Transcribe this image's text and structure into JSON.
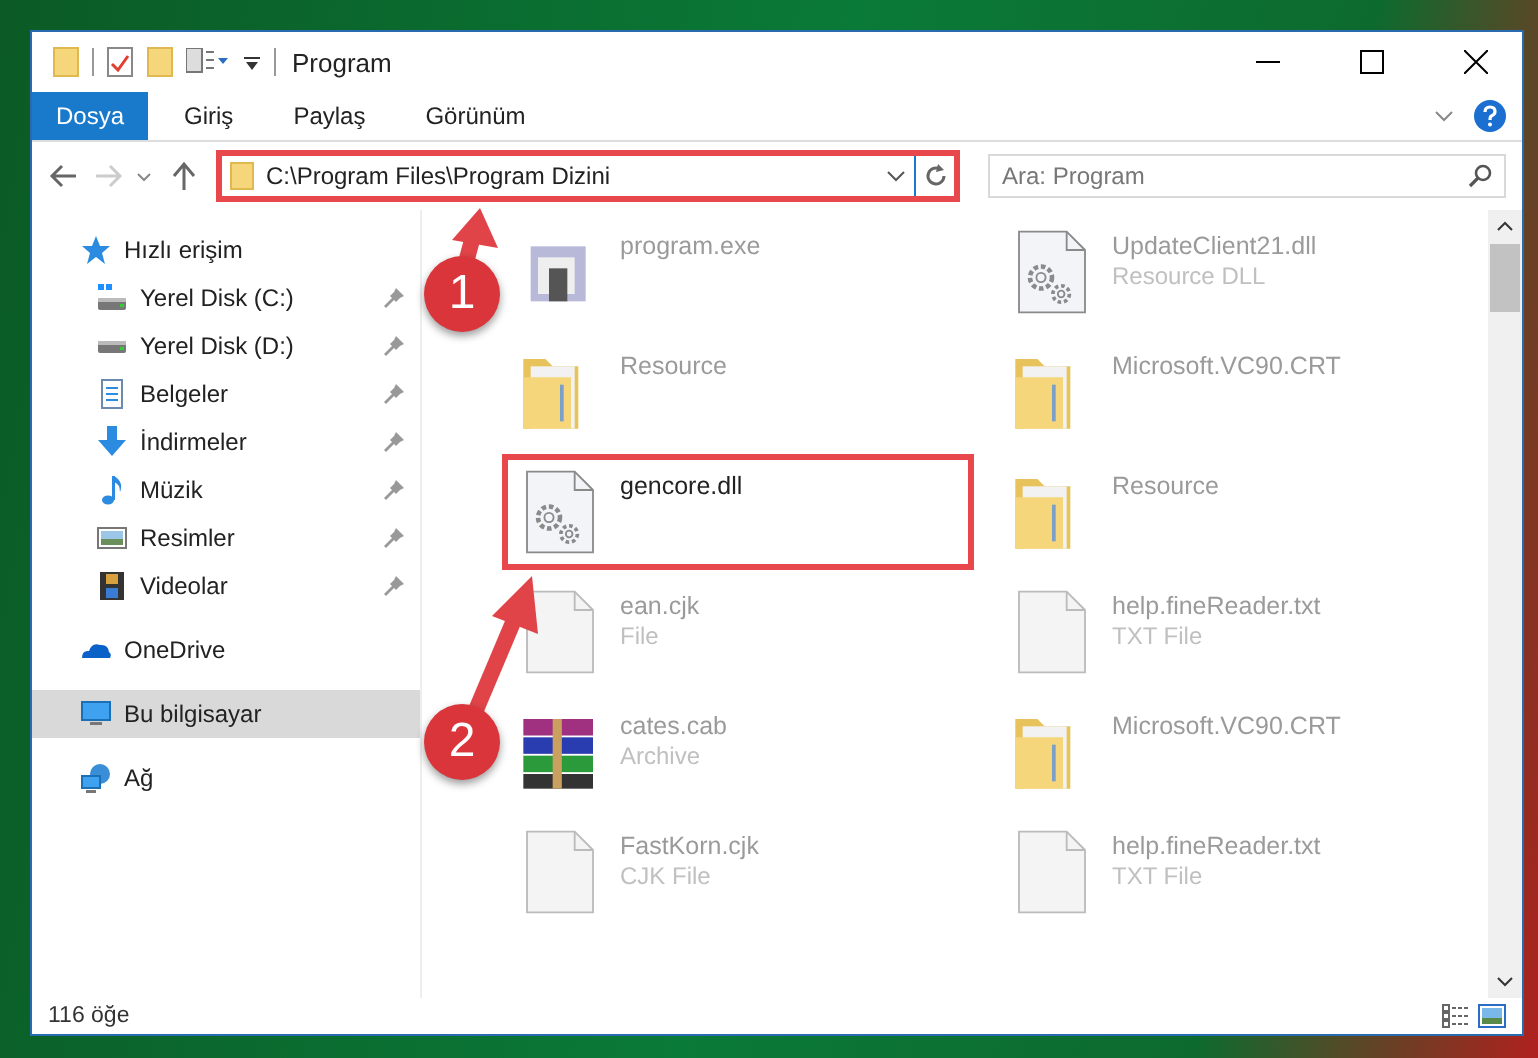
{
  "window": {
    "title": "Program"
  },
  "ribbon": {
    "tabs": [
      {
        "label": "Dosya",
        "selected": true
      },
      {
        "label": "Giriş",
        "selected": false
      },
      {
        "label": "Paylaş",
        "selected": false
      },
      {
        "label": "Görünüm",
        "selected": false
      }
    ]
  },
  "address_bar": {
    "path": "C:\\Program Files\\Program Dizini",
    "highlighted": true
  },
  "search": {
    "placeholder": "Ara: Program"
  },
  "sidebar": {
    "items": [
      {
        "label": "Hızlı erişim",
        "kind": "star",
        "selected": false,
        "children": [
          {
            "label": "Yerel Disk (C:)",
            "kind": "drive-c",
            "pinned": true,
            "selected": false
          },
          {
            "label": "Yerel Disk (D:)",
            "kind": "drive",
            "pinned": true,
            "selected": false
          },
          {
            "label": "Belgeler",
            "kind": "documents",
            "pinned": true,
            "selected": false
          },
          {
            "label": "İndirmeler",
            "kind": "downloads",
            "pinned": true,
            "selected": false
          },
          {
            "label": "Müzik",
            "kind": "music",
            "pinned": true,
            "selected": false
          },
          {
            "label": "Resimler",
            "kind": "pictures",
            "pinned": true,
            "selected": false
          },
          {
            "label": "Videolar",
            "kind": "videos",
            "pinned": true,
            "selected": false
          }
        ]
      },
      {
        "label": "OneDrive",
        "kind": "cloud",
        "selected": false
      },
      {
        "label": "Bu bilgisayar",
        "kind": "computer",
        "selected": true
      },
      {
        "label": "Ağ",
        "kind": "network",
        "selected": false
      }
    ]
  },
  "files": [
    {
      "name": "program.exe",
      "kind": "exe",
      "focused": false,
      "highlighted": false
    },
    {
      "name": "UpdateClient21.dll",
      "type": "Resource DLL",
      "kind": "dll",
      "focused": false,
      "highlighted": false
    },
    {
      "name": "Resource",
      "kind": "folder",
      "focused": false,
      "highlighted": false
    },
    {
      "name": "Microsoft.VC90.CRT",
      "kind": "folder",
      "focused": false,
      "highlighted": false
    },
    {
      "name": "gencore.dll",
      "kind": "dll",
      "focused": true,
      "highlighted": true
    },
    {
      "name": "Resource",
      "kind": "folder",
      "focused": false,
      "highlighted": false
    },
    {
      "name": "ean.cjk",
      "type": "File",
      "kind": "text",
      "focused": false,
      "highlighted": false
    },
    {
      "name": "help.fineReader.txt",
      "type": "TXT File",
      "kind": "text",
      "focused": false,
      "highlighted": false
    },
    {
      "name": "cates.cab",
      "type": "Archive",
      "kind": "archive",
      "focused": false,
      "highlighted": false
    },
    {
      "name": "Microsoft.VC90.CRT",
      "kind": "folder",
      "focused": false,
      "highlighted": false
    },
    {
      "name": "FastKorn.cjk",
      "type": "CJK File",
      "kind": "text",
      "focused": false,
      "highlighted": false
    },
    {
      "name": "help.fineReader.txt",
      "type": "TXT File",
      "kind": "text",
      "focused": false,
      "highlighted": false
    }
  ],
  "status_bar": {
    "count": "116 öğe"
  },
  "annotations": [
    {
      "number": "1"
    },
    {
      "number": "2"
    }
  ]
}
